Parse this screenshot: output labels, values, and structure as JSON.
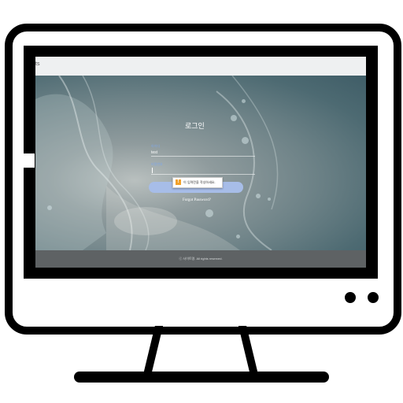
{
  "browser": {
    "tab_tail": "ts"
  },
  "login": {
    "title": "로그인",
    "username_label": "아이디",
    "username_value": "test",
    "password_label": "비밀번호",
    "password_value": "",
    "button_label": "LOGIN",
    "validation_message": "이 입력란을 작성하세요.",
    "forgot_password": "Forgot Password?"
  },
  "footer": {
    "copyright": "ⓒ 사이트명. All rights reserved."
  },
  "colors": {
    "accent_button": "#a7bde8",
    "label": "#7fa7e8",
    "warning": "#f2a12a"
  }
}
